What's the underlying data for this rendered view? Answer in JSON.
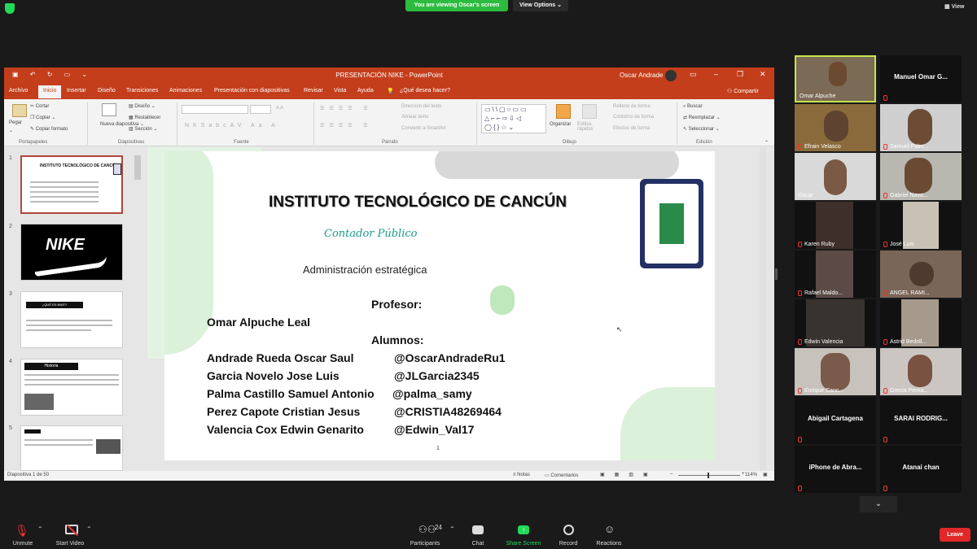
{
  "zoom": {
    "banner": "You are viewing Oscar's screen",
    "view_options": "View Options",
    "view_label": "View"
  },
  "ppt": {
    "title": "PRESENTACIÓN NIKE  -  PowerPoint",
    "user": "Oscar Andrade",
    "share": "Compartir",
    "tell_me": "¿Qué desea hacer?",
    "tabs": [
      "Archivo",
      "Inicio",
      "Insertar",
      "Diseño",
      "Transiciones",
      "Animaciones",
      "Presentación con diapositivas",
      "Revisar",
      "Vista",
      "Ayuda"
    ],
    "ribbon": {
      "paste": "Pegar",
      "cut": "Cortar",
      "copy": "Copiar",
      "format_painter": "Copiar formato",
      "clipboard": "Portapapeles",
      "new_slide": "Nueva diapositiva",
      "layout": "Diseño",
      "reset": "Restablecer",
      "section": "Sección",
      "slides": "Diapositivas",
      "font": "Fuente",
      "paragraph": "Párrafo",
      "text_direction": "Dirección del texto",
      "align_text": "Alinear texto",
      "smartart": "Convertir a SmartArt",
      "arrange": "Organizar",
      "quick_styles": "Estilos rápidos",
      "shape_fill": "Relleno de forma",
      "shape_outline": "Contorno de forma",
      "shape_effects": "Efectos de forma",
      "drawing": "Dibujo",
      "find": "Buscar",
      "replace": "Reemplazar",
      "select": "Seleccionar",
      "editing": "Edición"
    },
    "status": {
      "slide_count": "Diapositiva 1 de 50",
      "notes": "Notas",
      "comments": "Comentarios",
      "zoom": "114%"
    }
  },
  "slide": {
    "institute": "INSTITUTO TECNOLÓGICO DE CANCÚN",
    "career": "Contador Público",
    "subject": "Administración estratégica",
    "professor_label": "Profesor:",
    "professor": "Omar Alpuche Leal",
    "students_label": "Alumnos:",
    "students": [
      {
        "name": "Andrade Rueda Oscar Saul",
        "handle": "@OscarAndradeRu1"
      },
      {
        "name": "Garcia Novelo Jose Luis",
        "handle": "@JLGarcia2345"
      },
      {
        "name": "Palma Castillo Samuel Antonio",
        "handle": "@palma_samy"
      },
      {
        "name": "Perez Capote Cristian Jesus",
        "handle": "@CRISTIA48269464"
      },
      {
        "name": "Valencia Cox Edwin Genarito",
        "handle": "@Edwin_Val17"
      }
    ],
    "page_number": "1"
  },
  "thumbnails": [
    {
      "num": "1",
      "title": "INSTITUTO TECNOLÓGICO DE CANCÚN"
    },
    {
      "num": "2",
      "title": "NIKE"
    },
    {
      "num": "3",
      "title": "¿QUÉ ES NIKE?"
    },
    {
      "num": "4",
      "title": "Historia"
    },
    {
      "num": "5",
      "title": ""
    }
  ],
  "participants": [
    {
      "name": "Omar Alpuche",
      "video": true
    },
    {
      "name": "Manuel Omar G...",
      "video": false
    },
    {
      "name": "Efrain Velasco",
      "video": true
    },
    {
      "name": "Samuel Palm...",
      "video": true
    },
    {
      "name": "Oscar",
      "video": true
    },
    {
      "name": "Gabriel Nava...",
      "video": true
    },
    {
      "name": "Karen Ruby",
      "video": true
    },
    {
      "name": "José Luis",
      "video": true
    },
    {
      "name": "Rafael Maldo...",
      "video": true
    },
    {
      "name": "ANGEL RAMI...",
      "video": true
    },
    {
      "name": "Edwin Valencia",
      "video": true
    },
    {
      "name": "Astrid Bedoll...",
      "video": true
    },
    {
      "name": "Enrique Canc...",
      "video": true
    },
    {
      "name": "Grecia Perna...",
      "video": true
    },
    {
      "name": "Abigail Cartagena",
      "video": false
    },
    {
      "name": "SARAI RODRIG...",
      "video": false
    },
    {
      "name": "iPhone de Abra...",
      "video": false
    },
    {
      "name": "Atanai chan",
      "video": false
    }
  ],
  "bottom": {
    "unmute": "Unmute",
    "start_video": "Start Video",
    "participants": "Participants",
    "participants_count": "24",
    "chat": "Chat",
    "share_screen": "Share Screen",
    "record": "Record",
    "reactions": "Reactions",
    "leave": "Leave"
  },
  "colors": {
    "ppt_accent": "#c43e1c",
    "share_green": "#23d959",
    "leave_red": "#e02828",
    "career_teal": "#1a9a8a"
  }
}
